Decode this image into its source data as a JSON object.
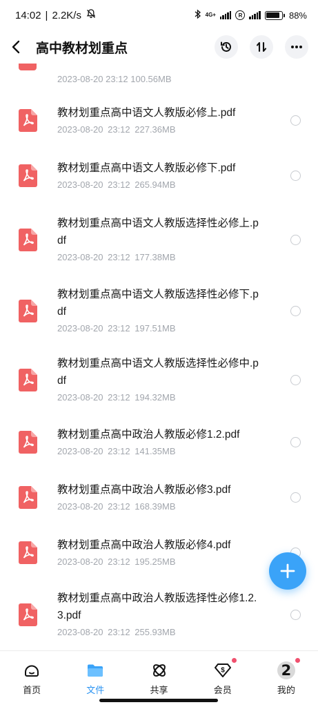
{
  "status_bar": {
    "time": "14:02",
    "speed": "2.2K/s",
    "network": "4G+",
    "battery": "88%",
    "battery_level": 0.88
  },
  "header": {
    "title": "高中教材划重点",
    "icons": [
      "back-icon",
      "history-icon",
      "sort-icon",
      "more-icon"
    ]
  },
  "partial_file": {
    "meta": "2023-08-20  23:12  100.56MB"
  },
  "files": [
    {
      "name": "教材划重点高中语文人教版必修上.pdf",
      "meta": "2023-08-20  23:12  227.36MB"
    },
    {
      "name": "教材划重点高中语文人教版必修下.pdf",
      "meta": "2023-08-20  23:12  265.94MB"
    },
    {
      "name": "教材划重点高中语文人教版选择性必修上.pdf",
      "meta": "2023-08-20  23:12  177.38MB"
    },
    {
      "name": "教材划重点高中语文人教版选择性必修下.pdf",
      "meta": "2023-08-20  23:12  197.51MB"
    },
    {
      "name": "教材划重点高中语文人教版选择性必修中.pdf",
      "meta": "2023-08-20  23:12  194.32MB"
    },
    {
      "name": "教材划重点高中政治人教版必修1.2.pdf",
      "meta": "2023-08-20  23:12  141.35MB"
    },
    {
      "name": "教材划重点高中政治人教版必修3.pdf",
      "meta": "2023-08-20  23:12  168.39MB"
    },
    {
      "name": "教材划重点高中政治人教版必修4.pdf",
      "meta": "2023-08-20  23:12  195.25MB"
    },
    {
      "name": "教材划重点高中政治人教版选择性必修1.2.3.pdf",
      "meta": "2023-08-20  23:12  255.93MB"
    }
  ],
  "bottom_nav": [
    {
      "label": "首页",
      "icon": "home-icon"
    },
    {
      "label": "文件",
      "icon": "folder-icon",
      "active": true
    },
    {
      "label": "共享",
      "icon": "share-icon"
    },
    {
      "label": "会员",
      "icon": "vip-icon",
      "dot": true
    },
    {
      "label": "我的",
      "icon": "avatar",
      "dot": true,
      "avatar_text": "2"
    }
  ],
  "colors": {
    "accent": "#2a93f2",
    "pdf": "#f06263",
    "fab": "#3aa3f8",
    "meta_text": "#a2a6ad",
    "dot": "#f0506e"
  }
}
